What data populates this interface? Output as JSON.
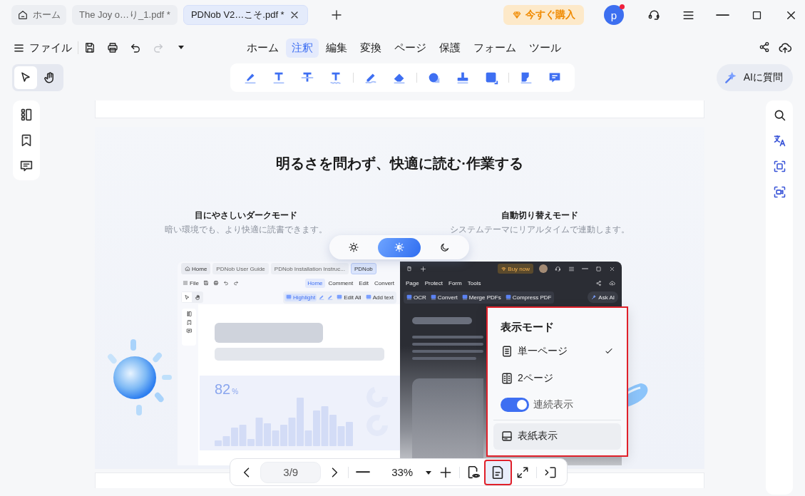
{
  "tabs": [
    {
      "kind": "home",
      "label": "ホーム",
      "selected": false
    },
    {
      "kind": "file",
      "label": "The Joy o…り_1.pdf *",
      "selected": false
    },
    {
      "kind": "file",
      "label": "PDNob V2…こそ.pdf *",
      "selected": true
    }
  ],
  "buy_button": "今すぐ購入",
  "avatar": {
    "initial": "p",
    "unread": true
  },
  "file_menu": "ファイル",
  "quick_actions": [
    {
      "kind": "save",
      "disabled": false
    },
    {
      "kind": "print",
      "disabled": false
    },
    {
      "kind": "undo",
      "disabled": false
    },
    {
      "kind": "redo",
      "disabled": true
    }
  ],
  "menu": [
    {
      "label": "ホーム",
      "selected": false
    },
    {
      "label": "注釈",
      "selected": true
    },
    {
      "label": "編集",
      "selected": false
    },
    {
      "label": "変換",
      "selected": false
    },
    {
      "label": "ページ",
      "selected": false
    },
    {
      "label": "保護",
      "selected": false
    },
    {
      "label": "フォーム",
      "selected": false
    },
    {
      "label": "ツール",
      "selected": false
    }
  ],
  "pointer_tools": [
    {
      "kind": "select",
      "selected": true
    },
    {
      "kind": "hand",
      "selected": false
    }
  ],
  "ai_button": "AIに質問",
  "document": {
    "title": "明るさを問わず、快適に読む·作業する",
    "features": [
      {
        "heading": "目にやさしいダークモード",
        "caption": "暗い環境でも、より快適に読書できます。"
      },
      {
        "heading": "自動切り替えモード",
        "caption": "システムテーマにリアルタイムで連動します。"
      }
    ],
    "theme_switch": [
      {
        "kind": "light",
        "selected": false
      },
      {
        "kind": "auto",
        "selected": true
      },
      {
        "kind": "dark",
        "selected": false
      }
    ],
    "mockup": {
      "tabs": [
        {
          "kind": "home",
          "label": "Home",
          "selected": false
        },
        {
          "kind": "file",
          "label": "PDNob User Guide",
          "selected": false
        },
        {
          "kind": "file",
          "label": "PDNob Installation Instruc...",
          "selected": false
        },
        {
          "kind": "file",
          "label": "PDNob",
          "selected": true
        }
      ],
      "buy_button": "Buy now",
      "file_menu": "File",
      "menu": [
        {
          "label": "Home",
          "selected": true,
          "dark": false
        },
        {
          "label": "Comment",
          "selected": false,
          "dark": false
        },
        {
          "label": "Edit",
          "selected": false,
          "dark": false
        },
        {
          "label": "Convert",
          "selected": false,
          "dark": false
        },
        {
          "label": "Page",
          "selected": false,
          "dark": true
        },
        {
          "label": "Protect",
          "selected": false,
          "dark": true
        },
        {
          "label": "Form",
          "selected": false,
          "dark": true
        },
        {
          "label": "Tools",
          "selected": false,
          "dark": true
        }
      ],
      "tools": [
        {
          "label": "Highlight",
          "selected": true,
          "dark": false
        },
        {
          "label": "Edit All",
          "selected": false,
          "dark": false
        },
        {
          "label": "Add text",
          "selected": false,
          "dark": false
        },
        {
          "label": "OCR",
          "selected": false,
          "dark": true
        },
        {
          "label": "Convert",
          "selected": false,
          "dark": true
        },
        {
          "label": "Merge PDFs",
          "selected": false,
          "dark": true
        },
        {
          "label": "Compress PDF",
          "selected": false,
          "dark": true
        }
      ],
      "ai_button": "Ask AI",
      "stat": {
        "value": "82",
        "unit": "%"
      }
    }
  },
  "view_menu": {
    "title": "表示モード",
    "framed": true,
    "items": [
      {
        "kind": "single",
        "label": "単一ページ",
        "checked": true,
        "hovered": false
      },
      {
        "kind": "double",
        "label": "2ページ",
        "checked": false,
        "hovered": false
      },
      {
        "kind": "toggle",
        "label": "連続表示",
        "on": true,
        "hovered": false
      },
      {
        "kind": "cover",
        "label": "表紙表示",
        "checked": false,
        "hovered": true
      }
    ]
  },
  "page_toolbar": {
    "page": "3/9",
    "zoom": "33%",
    "view_mode_framed": true
  }
}
